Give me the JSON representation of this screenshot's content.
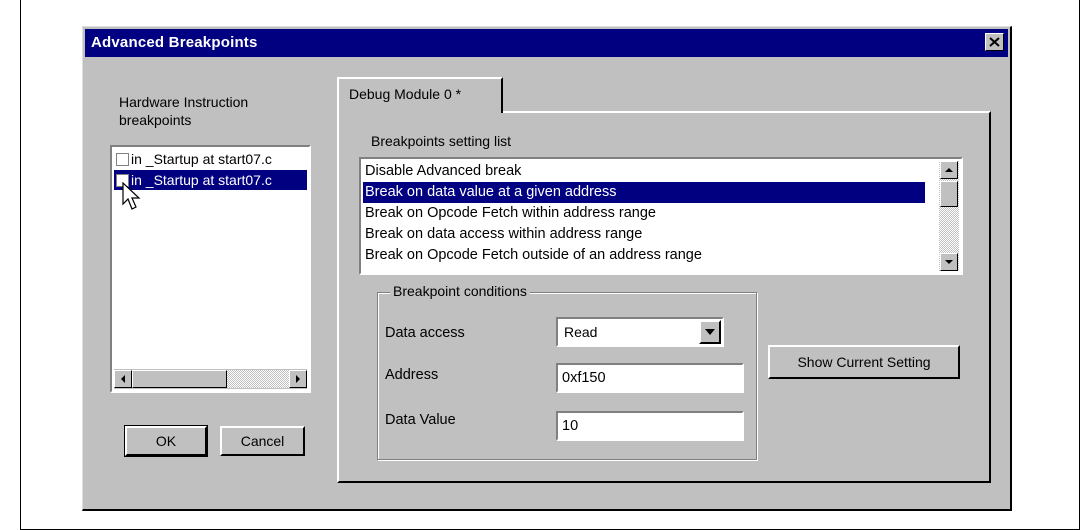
{
  "window": {
    "title": "Advanced Breakpoints"
  },
  "left_panel": {
    "label": "Hardware Instruction breakpoints",
    "items": [
      {
        "text": "in _Startup at start07.c",
        "checked": false,
        "selected": false
      },
      {
        "text": "in _Startup at start07.c",
        "checked": false,
        "selected": true
      }
    ]
  },
  "buttons": {
    "ok": "OK",
    "cancel": "Cancel",
    "show_current_setting": "Show Current Setting"
  },
  "tab": {
    "label": "Debug Module 0 *"
  },
  "breakpoints_list": {
    "label": "Breakpoints setting list",
    "items": [
      "Disable Advanced break",
      "Break on data value at a given address",
      "Break on Opcode Fetch within address range",
      "Break on data access within address range",
      "Break on Opcode Fetch outside of an address range"
    ],
    "selected_index": 1
  },
  "conditions": {
    "title": "Breakpoint conditions",
    "data_access_label": "Data access",
    "data_access_value": "Read",
    "address_label": "Address",
    "address_value": "0xf150",
    "data_value_label": "Data Value",
    "data_value_value": "10"
  }
}
